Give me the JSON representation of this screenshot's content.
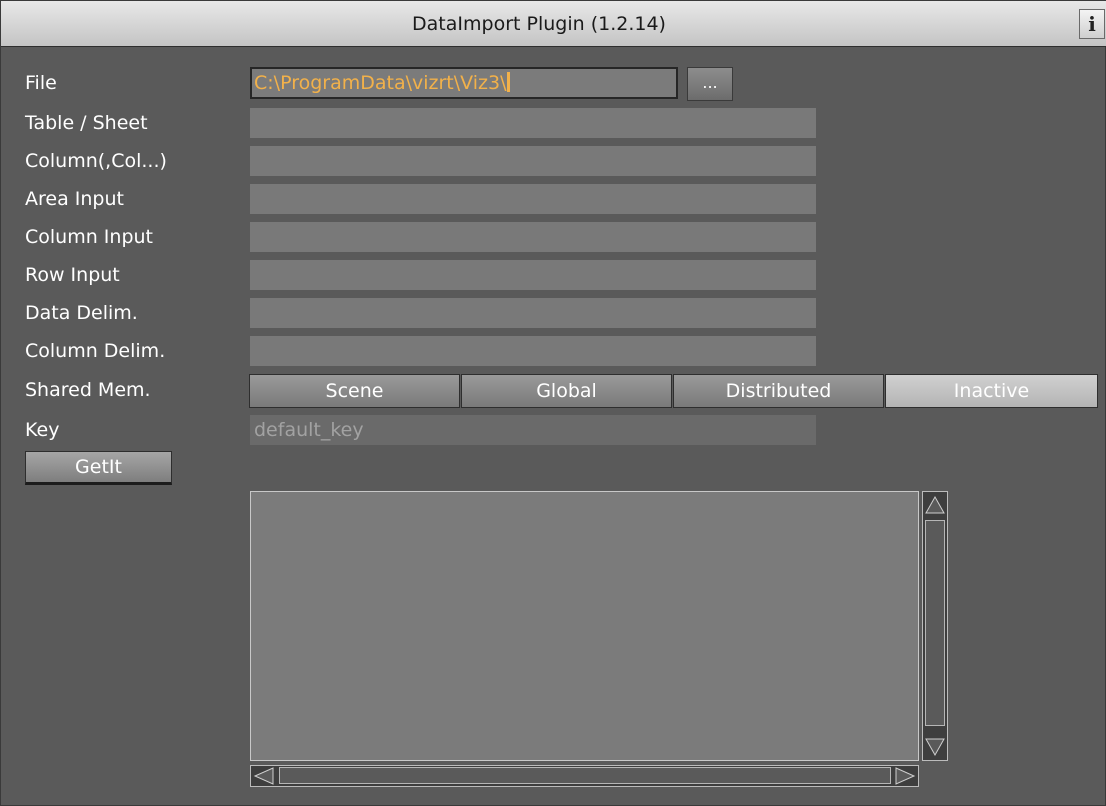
{
  "window": {
    "title": "DataImport Plugin (1.2.14)",
    "info_label": "i"
  },
  "form": {
    "labels": {
      "file": "File",
      "table_sheet": "Table / Sheet",
      "column": "Column(,Col...)",
      "area_input": "Area Input",
      "column_input": "Column Input",
      "row_input": "Row Input",
      "data_delim": "Data Delim.",
      "column_delim": "Column Delim.",
      "shared_mem": "Shared Mem.",
      "key": "Key"
    },
    "file_value": "C:\\ProgramData\\vizrt\\Viz3\\",
    "browse_label": "...",
    "table_sheet_value": "",
    "column_value": "",
    "area_input_value": "",
    "column_input_value": "",
    "row_input_value": "",
    "data_delim_value": "",
    "column_delim_value": "",
    "shared_mem_options": [
      "Scene",
      "Global",
      "Distributed",
      "Inactive"
    ],
    "shared_mem_selected": "Inactive",
    "key_value": "default_key",
    "getit_label": "GetIt",
    "output_text": ""
  },
  "colors": {
    "panel_bg": "#5a5a5a",
    "field_bg": "#797979",
    "file_text": "#f2b14a"
  }
}
